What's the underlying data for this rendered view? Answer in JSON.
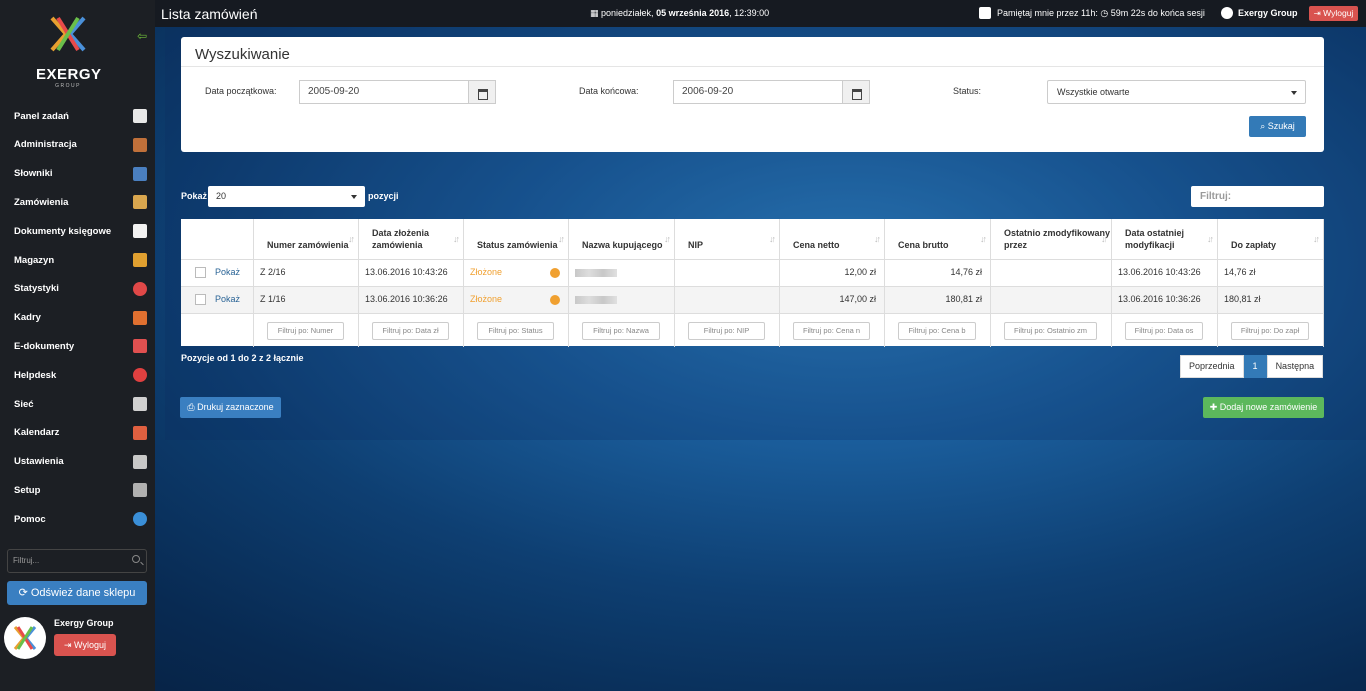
{
  "app": {
    "logo_text": "EXERGY",
    "logo_sub": "GROUP"
  },
  "topbar": {
    "page_title": "Lista zamówień",
    "datetime_prefix": "poniedziałek, ",
    "datetime_date": "05 września 2016",
    "datetime_time": ", 12:39:00",
    "remember_label": "Pamiętaj mnie przez 11h:",
    "session_time": "59m 22s",
    "session_suffix": "do końca sesji",
    "company": "Exergy Group",
    "logout": "Wyloguj"
  },
  "sidebar": {
    "items": [
      {
        "label": "Panel zadań",
        "icon": "home-icon",
        "color": "#e8e8e8"
      },
      {
        "label": "Administracja",
        "icon": "books-icon",
        "color": "#c0703a"
      },
      {
        "label": "Słowniki",
        "icon": "dictionary-icon",
        "color": "#4a7fc0"
      },
      {
        "label": "Zamówienia",
        "icon": "package-icon",
        "color": "#d9a64e"
      },
      {
        "label": "Dokumenty księgowe",
        "icon": "document-icon",
        "color": "#f2f2f2"
      },
      {
        "label": "Magazyn",
        "icon": "forklift-icon",
        "color": "#e0a030"
      },
      {
        "label": "Statystyki",
        "icon": "pie-chart-icon",
        "color": "#e04848"
      },
      {
        "label": "Kadry",
        "icon": "person-icon",
        "color": "#e07030"
      },
      {
        "label": "E-dokumenty",
        "icon": "pdf-icon",
        "color": "#e05050"
      },
      {
        "label": "Helpdesk",
        "icon": "lifebuoy-icon",
        "color": "#e04040"
      },
      {
        "label": "Sieć",
        "icon": "tools-icon",
        "color": "#d0d0d0"
      },
      {
        "label": "Kalendarz",
        "icon": "calendar-icon",
        "color": "#e06040"
      },
      {
        "label": "Ustawienia",
        "icon": "gear-icon",
        "color": "#c8c8c8"
      },
      {
        "label": "Setup",
        "icon": "setup-icon",
        "color": "#b0b0b0"
      },
      {
        "label": "Pomoc",
        "icon": "help-icon",
        "color": "#3a8fd8"
      }
    ],
    "filter_placeholder": "Filtruj...",
    "refresh_button": "Odśwież dane sklepu",
    "user_name": "Exergy Group",
    "logout_button": "Wyloguj"
  },
  "search": {
    "title": "Wyszukiwanie",
    "start_label": "Data początkowa:",
    "start_value": "2005-09-20",
    "end_label": "Data końcowa:",
    "end_value": "2006-09-20",
    "status_label": "Status:",
    "status_value": "Wszystkie otwarte",
    "search_button": "Szukaj"
  },
  "table_controls": {
    "show_label": "Pokaż",
    "page_size": "20",
    "positions_label": "pozycji",
    "filter_label": "Filtruj:"
  },
  "table": {
    "headers": [
      "Numer zamówienia",
      "Data złożenia zamówienia",
      "Status zamówienia",
      "Nazwa kupującego",
      "NIP",
      "Cena netto",
      "Cena brutto",
      "Ostatnio zmodyfikowany przez",
      "Data ostatniej modyfikacji",
      "Do zapłaty"
    ],
    "rows": [
      {
        "action": "Pokaż",
        "number": "Z 2/16",
        "date": "13.06.2016 10:43:26",
        "status": "Złożone",
        "buyer": "",
        "nip": "",
        "net": "12,00 zł",
        "gross": "14,76 zł",
        "modified_by": "",
        "modified_date": "13.06.2016 10:43:26",
        "to_pay": "14,76 zł"
      },
      {
        "action": "Pokaż",
        "number": "Z 1/16",
        "date": "13.06.2016 10:36:26",
        "status": "Złożone",
        "buyer": "",
        "nip": "",
        "net": "147,00 zł",
        "gross": "180,81 zł",
        "modified_by": "",
        "modified_date": "13.06.2016 10:36:26",
        "to_pay": "180,81 zł"
      }
    ],
    "filters": [
      "Filtruj po: Numer",
      "Filtruj po: Data zł",
      "Filtruj po: Status",
      "Filtruj po: Nazwa",
      "Filtruj po: NIP",
      "Filtruj po: Cena n",
      "Filtruj po: Cena b",
      "Filtruj po: Ostatnio zm",
      "Filtruj po: Data os",
      "Filtruj po: Do zapł"
    ]
  },
  "footer": {
    "info": "Pozycje od 1 do 2 z 2 łącznie",
    "prev": "Poprzednia",
    "page": "1",
    "next": "Następna",
    "print_button": "Drukuj zaznaczone",
    "add_button": "Dodaj nowe zamówienie"
  },
  "colors": {
    "primary": "#337ab7",
    "danger": "#d9534f",
    "success": "#5cb85c",
    "status_orange": "#f0a030"
  }
}
